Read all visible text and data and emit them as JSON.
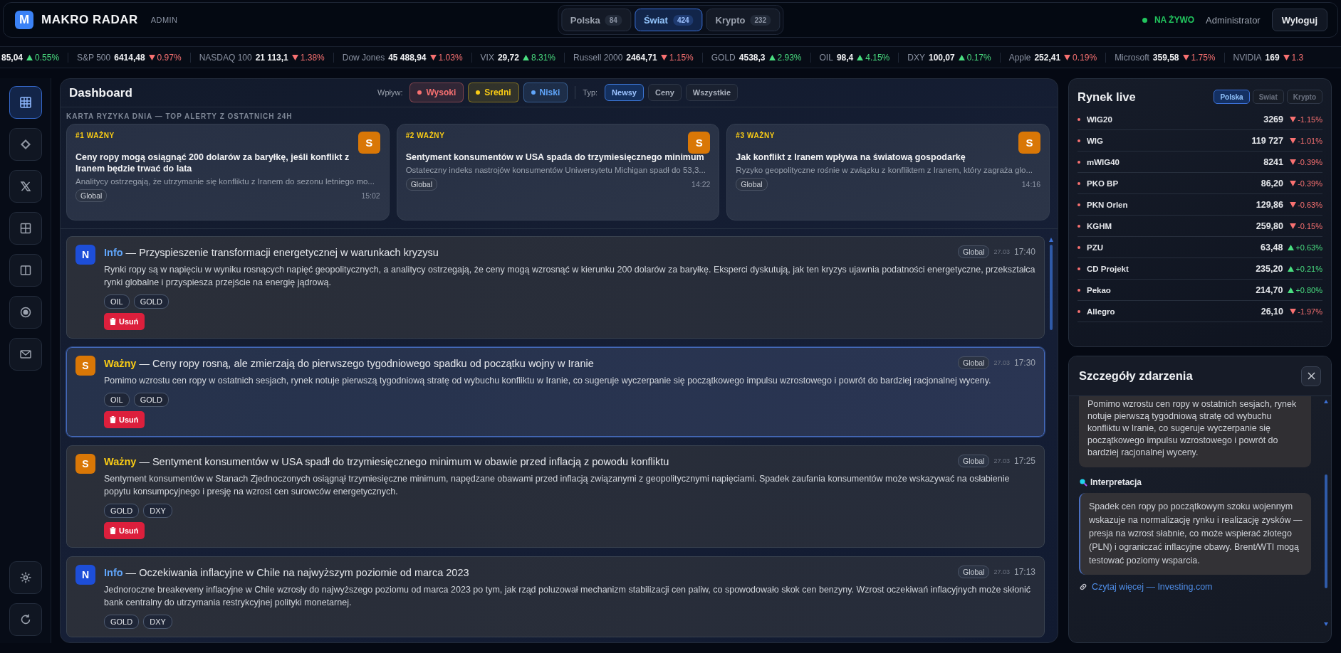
{
  "header": {
    "logo_letter": "M",
    "title": "MAKRO RADAR",
    "role": "ADMIN",
    "tabs": [
      {
        "label": "Polska",
        "count": "84",
        "selected": false
      },
      {
        "label": "Świat",
        "count": "424",
        "selected": true
      },
      {
        "label": "Krypto",
        "count": "232",
        "selected": false
      }
    ],
    "live": "NA ŻYWO",
    "user": "Administrator",
    "logout": "Wyloguj"
  },
  "ticker": [
    {
      "value": "85,04",
      "rising": true,
      "change": "0.55%"
    },
    {
      "name": "S&P 500",
      "value": "6414,48",
      "rising": false,
      "change": "0.97%"
    },
    {
      "name": "NASDAQ 100",
      "value": "21 113,1",
      "rising": false,
      "change": "1.38%"
    },
    {
      "name": "Dow Jones",
      "value": "45 488,94",
      "rising": false,
      "change": "1.03%"
    },
    {
      "name": "VIX",
      "value": "29,72",
      "rising": true,
      "change": "8.31%"
    },
    {
      "name": "Russell 2000",
      "value": "2464,71",
      "rising": false,
      "change": "1.15%"
    },
    {
      "name": "GOLD",
      "value": "4538,3",
      "rising": true,
      "change": "2.93%"
    },
    {
      "name": "OIL",
      "value": "98,4",
      "rising": true,
      "change": "4.15%"
    },
    {
      "name": "DXY",
      "value": "100,07",
      "rising": true,
      "change": "0.17%"
    },
    {
      "name": "Apple",
      "value": "252,41",
      "rising": false,
      "change": "0.19%"
    },
    {
      "name": "Microsoft",
      "value": "359,58",
      "rising": false,
      "change": "1.75%"
    },
    {
      "name": "NVIDIA",
      "value": "169",
      "rising": false,
      "change": "1.3"
    }
  ],
  "sidebar": {
    "items": [
      {
        "selected": true
      },
      {
        "selected": false
      },
      {
        "selected": false
      },
      {
        "selected": false
      },
      {
        "selected": false
      },
      {
        "selected": false
      },
      {
        "selected": false
      }
    ]
  },
  "dashboard": {
    "title": "Dashboard",
    "impact_label": "Wpływ:",
    "impact_filters": [
      {
        "label": "Wysoki",
        "color": "#f87171"
      },
      {
        "label": "Sredni",
        "color": "#facc15"
      },
      {
        "label": "Niski",
        "color": "#60a5fa"
      }
    ],
    "type_label": "Typ:",
    "type_filters": [
      {
        "label": "Newsy",
        "selected": true
      },
      {
        "label": "Ceny",
        "selected": false
      },
      {
        "label": "Wszystkie",
        "selected": false
      }
    ],
    "alerts_heading": "KARTA RYZYKA DNIA — TOP ALERTY Z OSTATNICH 24H",
    "alerts": [
      {
        "rank": "#1 WAŻNY",
        "badge": "S",
        "title": "Ceny ropy mogą osiągnąć 200 dolarów za baryłkę, jeśli konflikt z Iranem będzie trwać do lata",
        "summary": "Analitycy ostrzegają, że utrzymanie się konfliktu z Iranem do sezonu letniego mo...",
        "tag": "Global",
        "time": "15:02"
      },
      {
        "rank": "#2 WAŻNY",
        "badge": "S",
        "title": "Sentyment konsumentów w USA spada do trzymiesięcznego minimum",
        "summary": "Ostateczny indeks nastrojów konsumentów Uniwersytetu Michigan spadł do 53,3...",
        "tag": "Global",
        "time": "14:22"
      },
      {
        "rank": "#3 WAŻNY",
        "badge": "S",
        "title": "Jak konflikt z Iranem wpływa na światową gospodarkę",
        "summary": "Ryzyko geopolityczne rośnie w związku z konfliktem z Iranem, który zagraża glo...",
        "tag": "Global",
        "time": "14:16"
      }
    ],
    "feed": [
      {
        "kind": "info",
        "badge": "N",
        "headline": "**Info** — Przyspieszenie transformacji energetycznej w warunkach kryzysu",
        "region": "Global",
        "date": "27.03",
        "time": "17:40",
        "selected": false,
        "body": "Rynki ropy są w napięciu w wyniku rosnących napięć geopolitycznych, a analitycy ostrzegają, że ceny mogą wzrosnąć w kierunku 200 dolarów za baryłkę. Eksperci dyskutują, jak ten kryzys ujawnia podatności energetyczne, przekształca rynki globalne i przyspiesza przejście na energię jądrową.",
        "tags": [
          "OIL",
          "GOLD"
        ],
        "delete": "Usuń"
      },
      {
        "kind": "important",
        "badge": "S",
        "headline": "**Ważny** — Ceny ropy rosną, ale zmierzają do pierwszego tygodniowego spadku od początku wojny w Iranie",
        "region": "Global",
        "date": "27.03",
        "time": "17:30",
        "selected": true,
        "body": "Pomimo wzrostu cen ropy w ostatnich sesjach, rynek notuje pierwszą tygodniową stratę od wybuchu konfliktu w Iranie, co sugeruje wyczerpanie się początkowego impulsu wzrostowego i powrót do bardziej racjonalnej wyceny.",
        "tags": [
          "OIL",
          "GOLD"
        ],
        "delete": "Usuń"
      },
      {
        "kind": "important",
        "badge": "S",
        "headline": "**Ważny** — Sentyment konsumentów w USA spadł do trzymiesięcznego minimum w obawie przed inflacją z powodu konfliktu",
        "region": "Global",
        "date": "27.03",
        "time": "17:25",
        "selected": false,
        "body": "Sentyment konsumentów w Stanach Zjednoczonych osiągnął trzymiesięczne minimum, napędzane obawami przed inflacją związanymi z geopolitycznymi napięciami. Spadek zaufania konsumentów może wskazywać na osłabienie popytu konsumpcyjnego i presję na wzrost cen surowców energetycznych.",
        "tags": [
          "GOLD",
          "DXY"
        ],
        "delete": "Usuń"
      },
      {
        "kind": "info",
        "badge": "N",
        "headline": "**Info** — Oczekiwania inflacyjne w Chile na najwyższym poziomie od marca 2023",
        "region": "Global",
        "date": "27.03",
        "time": "17:13",
        "selected": false,
        "body": "Jednoroczne breakeveny inflacyjne w Chile wzrosły do najwyższego poziomu od marca 2023 po tym, jak rząd poluzował mechanizm stabilizacji cen paliw, co spowodowało skok cen benzyny. Wzrost oczekiwań inflacyjnych może skłonić bank centralny do utrzymania restrykcyjnej polityki monetarnej.",
        "tags": [
          "GOLD",
          "DXY"
        ]
      }
    ]
  },
  "market": {
    "title": "Rynek live",
    "tabs": [
      {
        "label": "Polska",
        "selected": true
      },
      {
        "label": "Swiat",
        "selected": false
      },
      {
        "label": "Krypto",
        "selected": false
      }
    ],
    "rows": [
      {
        "name": "WIG20",
        "value": "3269",
        "rising": false,
        "change": "-1.15%"
      },
      {
        "name": "WIG",
        "value": "119 727",
        "rising": false,
        "change": "-1.01%"
      },
      {
        "name": "mWIG40",
        "value": "8241",
        "rising": false,
        "change": "-0.39%"
      },
      {
        "name": "PKO BP",
        "value": "86,20",
        "rising": false,
        "change": "-0.39%"
      },
      {
        "name": "PKN Orlen",
        "value": "129,86",
        "rising": false,
        "change": "-0.63%"
      },
      {
        "name": "KGHM",
        "value": "259,80",
        "rising": false,
        "change": "-0.15%"
      },
      {
        "name": "PZU",
        "value": "63,48",
        "rising": true,
        "change": "+0.63%"
      },
      {
        "name": "CD Projekt",
        "value": "235,20",
        "rising": true,
        "change": "+0.21%"
      },
      {
        "name": "Pekao",
        "value": "214,70",
        "rising": true,
        "change": "+0.80%"
      },
      {
        "name": "Allegro",
        "value": "26,10",
        "rising": false,
        "change": "-1.97%"
      }
    ]
  },
  "details": {
    "title": "Szczegóły zdarzenia",
    "description": "Pomimo wzrostu cen ropy w ostatnich sesjach, rynek notuje pierwszą tygodniową stratę od wybuchu konfliktu w Iranie, co sugeruje wyczerpanie się początkowego impulsu wzrostowego i powrót do bardziej racjonalnej wyceny.",
    "interpretation_heading": "Interpretacja",
    "interpretation": "Spadek cen ropy po początkowym szoku wojennym wskazuje na normalizację rynku i realizację zysków — presja na wzrost słabnie, co może wspierać złotego (PLN) i ograniczać inflacyjne obawy. Brent/WTI mogą testować poziomy wsparcia.",
    "link": "Czytaj więcej — Investing.com"
  }
}
